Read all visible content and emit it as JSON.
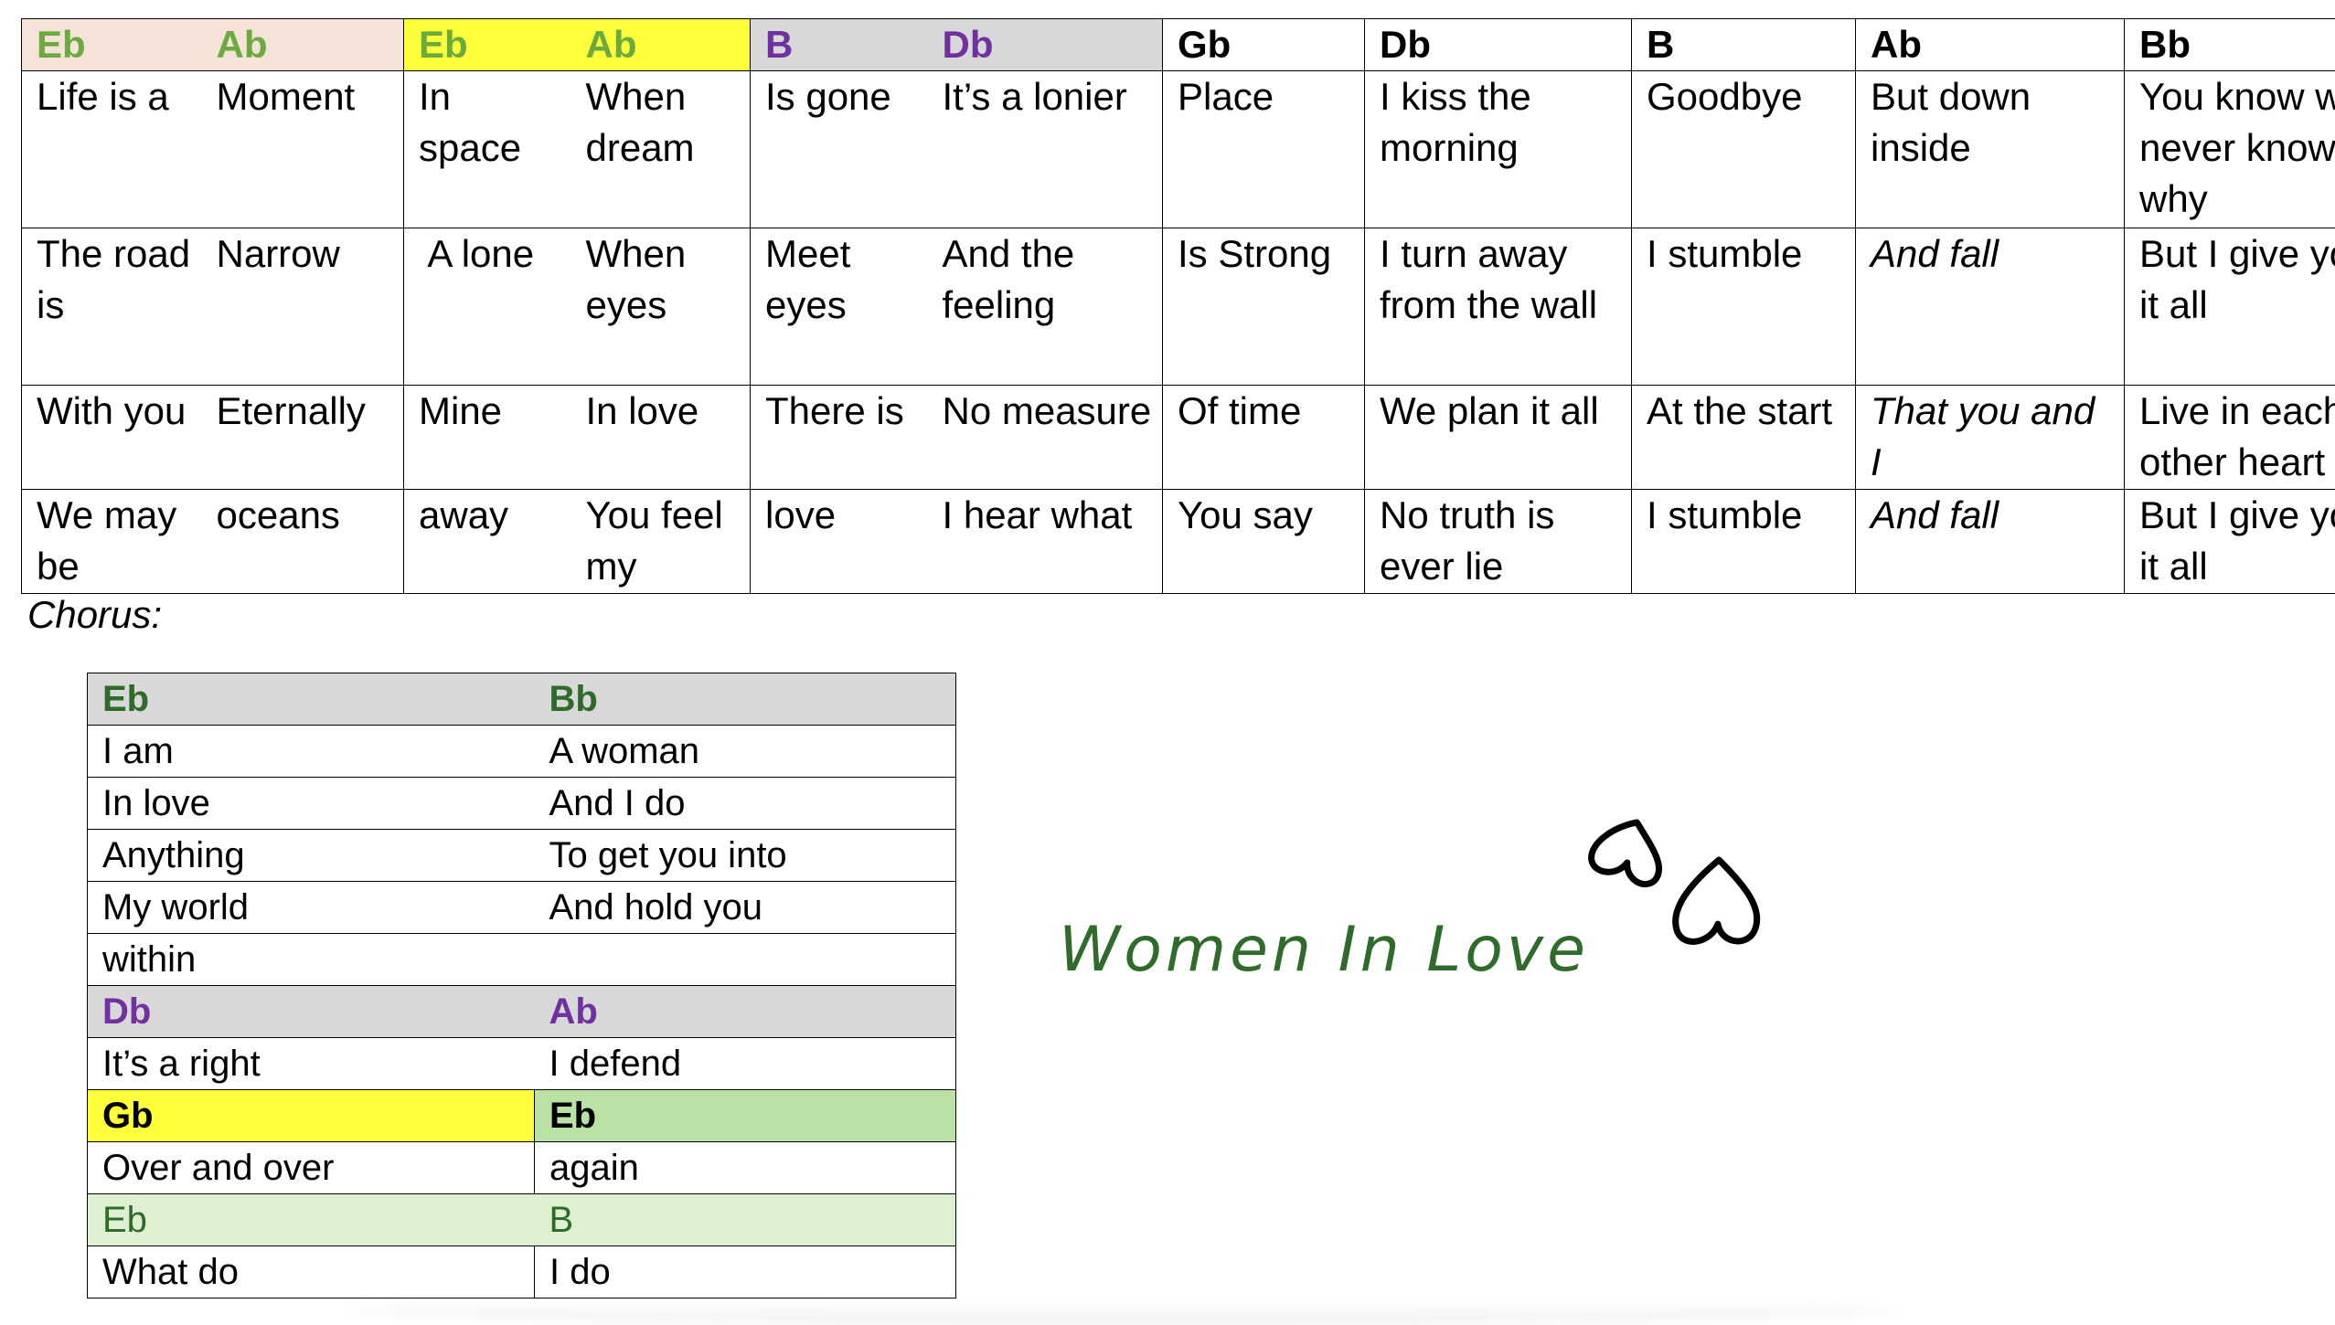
{
  "colors": {
    "green_text": "#6aab3e",
    "dark_green_text": "#2e6b2a",
    "purple_text": "#7030a0",
    "peach_bg": "#f5e2d8",
    "yellow_bg": "#ffff3c",
    "grey_bg": "#d8d8d8",
    "light_green_bg": "#b9e2a4",
    "pale_green_bg": "#dff0d2",
    "title_green": "#2f6b2a"
  },
  "verse_table": {
    "chords": [
      "Eb",
      "Ab",
      "Eb",
      "Ab",
      "B",
      "Db",
      "Gb",
      "Db",
      "B",
      "Ab",
      "Bb"
    ],
    "rows": [
      [
        "Life is a",
        "Moment",
        "In space",
        "When dream",
        "Is gone",
        "It’s a lonier",
        "Place",
        "I kiss the morning",
        "Goodbye",
        "But down inside",
        "You know we never know why"
      ],
      [
        "The road is",
        "Narrow",
        " A lone",
        "When eyes",
        "Meet eyes",
        "And the feeling",
        "Is Strong",
        "I turn away from the wall",
        "I stumble",
        "And fall",
        "But I give you it all"
      ],
      [
        "With you",
        "Eternally",
        "Mine",
        "In love",
        "There is",
        "No measure",
        "Of time",
        "We plan it all",
        "At the start",
        "That you and I",
        "Live in each other heart"
      ],
      [
        "We may be",
        "oceans",
        "away",
        "You feel my",
        "love",
        "I hear what",
        "You say",
        "No truth is ever lie",
        "I stumble",
        "And fall",
        "But I give you it all"
      ]
    ]
  },
  "chorus_label": "Chorus:",
  "chorus_table": {
    "rows": [
      [
        "Eb",
        "Bb"
      ],
      [
        "I am",
        "A woman"
      ],
      [
        "In love",
        "And I do"
      ],
      [
        "Anything",
        "To get you into"
      ],
      [
        "My world",
        "And hold you"
      ],
      [
        "within",
        ""
      ],
      [
        "Db",
        "Ab"
      ],
      [
        "It’s a right",
        "I defend"
      ],
      [
        "Gb",
        "Eb"
      ],
      [
        "Over and over",
        "again"
      ],
      [
        "Eb",
        "B"
      ],
      [
        "What do",
        "I do"
      ]
    ]
  },
  "title": "Women In Love",
  "decoration": {
    "icon": "hearts-icon"
  }
}
